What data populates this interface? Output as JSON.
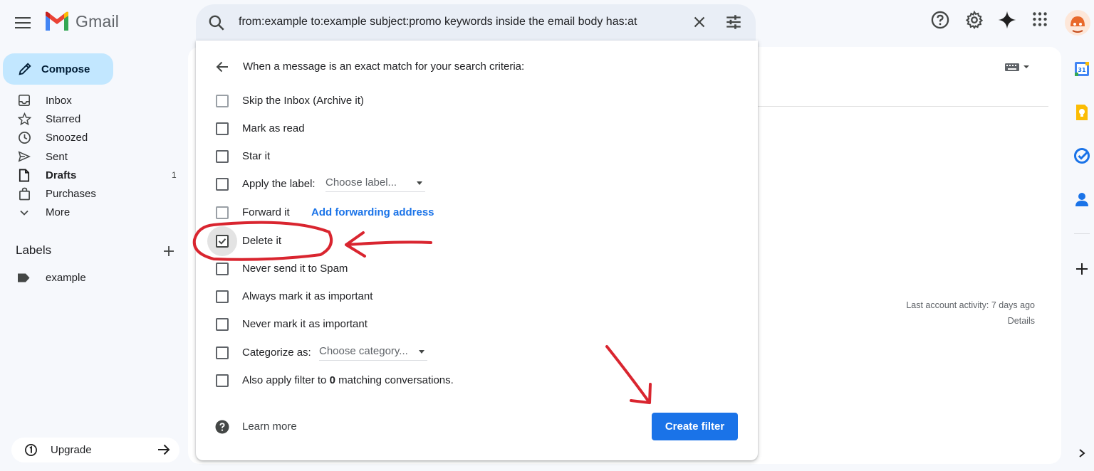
{
  "app": {
    "name": "Gmail"
  },
  "search": {
    "query": "from:example to:example subject:promo keywords inside the email body has:at"
  },
  "sidebar": {
    "compose_label": "Compose",
    "items": [
      {
        "label": "Inbox",
        "icon": "inbox-icon",
        "bold": false,
        "count": ""
      },
      {
        "label": "Starred",
        "icon": "star-icon",
        "bold": false,
        "count": ""
      },
      {
        "label": "Snoozed",
        "icon": "clock-icon",
        "bold": false,
        "count": ""
      },
      {
        "label": "Sent",
        "icon": "send-icon",
        "bold": false,
        "count": ""
      },
      {
        "label": "Drafts",
        "icon": "draft-icon",
        "bold": true,
        "count": "1"
      },
      {
        "label": "Purchases",
        "icon": "shopping-bag-icon",
        "bold": false,
        "count": ""
      },
      {
        "label": "More",
        "icon": "chevron-down-icon",
        "bold": false,
        "count": ""
      }
    ],
    "labels_heading": "Labels",
    "labels": [
      {
        "label": "example",
        "icon": "label-icon"
      }
    ],
    "upgrade_label": "Upgrade"
  },
  "filter_dialog": {
    "heading": "When a message is an exact match for your search criteria:",
    "options": {
      "skip_inbox": {
        "label": "Skip the Inbox (Archive it)",
        "checked": false
      },
      "mark_read": {
        "label": "Mark as read",
        "checked": false
      },
      "star_it": {
        "label": "Star it",
        "checked": false
      },
      "apply_label": {
        "label": "Apply the label:",
        "select_value": "Choose label...",
        "checked": false
      },
      "forward_it": {
        "label": "Forward it",
        "link": "Add forwarding address",
        "checked": false
      },
      "delete_it": {
        "label": "Delete it",
        "checked": true
      },
      "never_spam": {
        "label": "Never send it to Spam",
        "checked": false
      },
      "always_important": {
        "label": "Always mark it as important",
        "checked": false
      },
      "never_important": {
        "label": "Never mark it as important",
        "checked": false
      },
      "categorize": {
        "label": "Categorize as:",
        "select_value": "Choose category...",
        "checked": false
      },
      "also_apply": {
        "prefix": "Also apply filter to ",
        "count": "0",
        "suffix": " matching conversations.",
        "checked": false
      }
    },
    "learn_more": "Learn more",
    "create_button": "Create filter"
  },
  "main": {
    "last_activity": "Last account activity: 7 days ago",
    "details_link": "Details"
  },
  "colors": {
    "accent": "#1a73e8",
    "compose_bg": "#c2e7ff",
    "annotation_red": "#d9252f"
  }
}
